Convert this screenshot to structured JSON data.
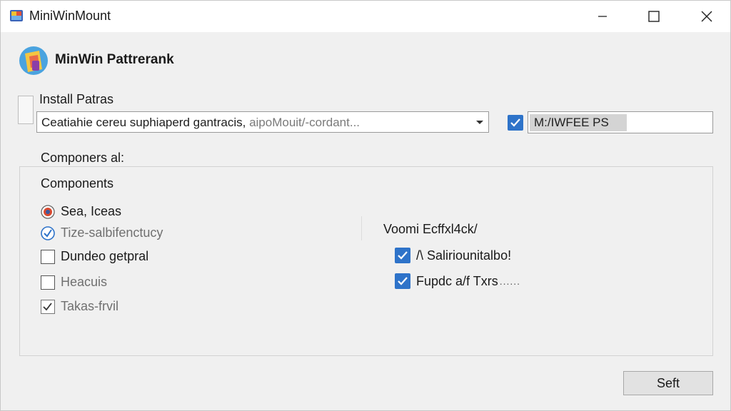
{
  "window": {
    "title": "MiniWinMount",
    "header_title": "MinWin Pattrerank"
  },
  "install": {
    "label": "Install Patras",
    "combo_value": "Ceatiahie cereu suphiaperd gantracis,",
    "combo_value_tail": " aipoMouit/-cordant...",
    "path_value": "M:/IWFEE PS",
    "path_checked": true
  },
  "components_section": {
    "label": "Componers al:",
    "group_title": "Components",
    "left_options": [
      {
        "label": "Sea, Iceas",
        "kind": "radio-badge"
      },
      {
        "label": "Tize-salbifenctucy",
        "kind": "radio-checked"
      },
      {
        "label": "Dundeo getpral",
        "kind": "checkbox",
        "checked": false
      },
      {
        "label": "Heacuis",
        "kind": "checkbox",
        "checked": false
      },
      {
        "label": "Takas-frvil",
        "kind": "checkbox",
        "checked": true
      }
    ],
    "right_heading": "Voomi Ecffxl4ck/",
    "right_options": [
      {
        "label": "/\\ Saliriounitalbo!",
        "checked": true
      },
      {
        "label": "Fupdc a/f Txrs",
        "suffix": "......",
        "checked": true
      }
    ]
  },
  "footer": {
    "button_label": "Seft"
  },
  "colors": {
    "accent": "#2e73c9",
    "window_bg": "#f0f0f0",
    "titlebar_bg": "#ffffff"
  }
}
